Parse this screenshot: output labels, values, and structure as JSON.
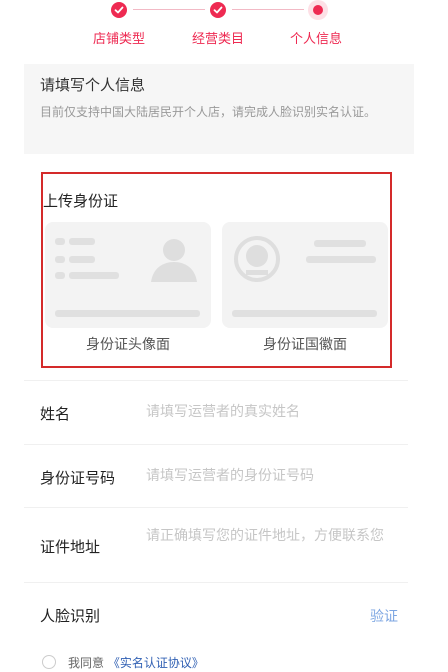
{
  "stepper": {
    "steps": [
      {
        "label": "店铺类型",
        "state": "done"
      },
      {
        "label": "经营类目",
        "state": "done"
      },
      {
        "label": "个人信息",
        "state": "current"
      }
    ],
    "accent_color": "#ee2a52"
  },
  "info": {
    "title": "请填写个人信息",
    "desc": "目前仅支持中国大陆居民开个人店，请完成人脸识别实名认证。"
  },
  "upload": {
    "title": "上传身份证",
    "front_label": "身份证头像面",
    "back_label": "身份证国徽面"
  },
  "form": {
    "name_label": "姓名",
    "name_placeholder": "请填写运营者的真实姓名",
    "id_label": "身份证号码",
    "id_placeholder": "请填写运营者的身份证号码",
    "address_label": "证件地址",
    "address_placeholder": "请正确填写您的证件地址，方便联系您",
    "face_label": "人脸识别",
    "face_action": "验证"
  },
  "agreement": {
    "prefix": "我同意",
    "link": "《实名认证协议》"
  }
}
